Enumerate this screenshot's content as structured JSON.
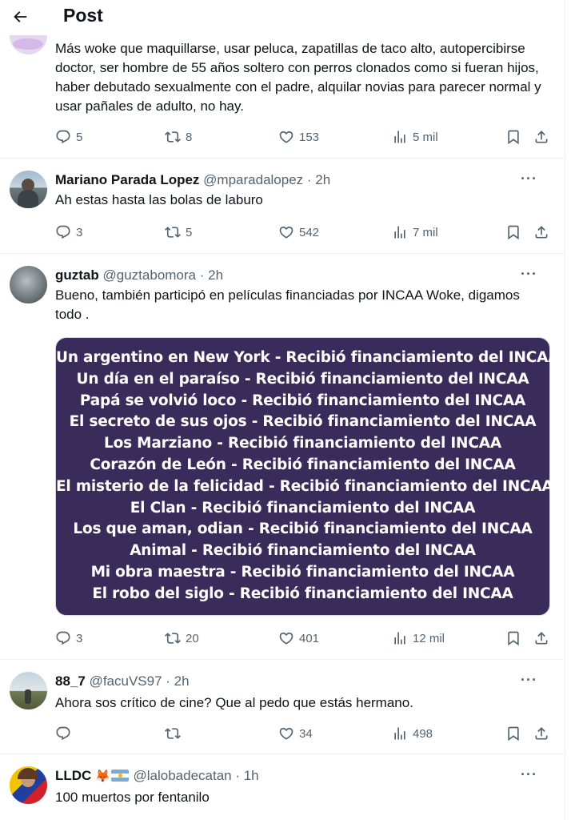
{
  "header": {
    "title": "Post"
  },
  "colors": {
    "media_bg": "#3a2c5a",
    "muted": "#536471",
    "text": "#0f1419"
  },
  "tweets": [
    {
      "text": "Más woke que maquillarse, usar peluca, zapatillas de taco alto, autopercibirse doctor, ser hombre de 55 años soltero con perros clonados como si fueran hijos, haber debutado sexualmente con el padre, alquilar novias para parecer normal y usar pañales de adulto, no hay.",
      "replies": "5",
      "retweets": "8",
      "likes": "153",
      "views": "5 mil"
    },
    {
      "name": "Mariano Parada Lopez",
      "handle": "@mparadalopez · 2h",
      "text": "Ah estas hasta las bolas de laburo",
      "replies": "3",
      "retweets": "5",
      "likes": "542",
      "views": "7 mil"
    },
    {
      "name": "guztab",
      "handle": "@guztabomora · 2h",
      "text": "Bueno, también participó en películas financiadas por INCAA Woke, digamos todo .",
      "media_lines": [
        "Un argentino en New York - Recibió financiamiento del INCAA",
        "Un día en el paraíso - Recibió financiamiento del INCAA",
        "Papá se volvió loco - Recibió financiamiento del INCAA",
        "El secreto de sus ojos - Recibió financiamiento del INCAA",
        "Los Marziano - Recibió financiamiento del INCAA",
        "Corazón de León - Recibió financiamiento del INCAA",
        "El misterio de la felicidad - Recibió financiamiento del INCAA",
        "El Clan - Recibió financiamiento del INCAA",
        "Los que aman, odian - Recibió financiamiento del INCAA",
        "Animal - Recibió financiamiento del INCAA",
        "Mi obra maestra - Recibió financiamiento del INCAA",
        "El robo del siglo - Recibió financiamiento del INCAA"
      ],
      "replies": "3",
      "retweets": "20",
      "likes": "401",
      "views": "12 mil"
    },
    {
      "name": "88_7",
      "handle": "@facuVS97 · 2h",
      "text": "Ahora sos crítico de cine? Que al pedo que estás hermano.",
      "replies": "",
      "retweets": "",
      "likes": "34",
      "views": "498"
    },
    {
      "name": "LLDC",
      "handle": "@lalobadecatan · 1h",
      "text": "100 muertos por fentanilo"
    }
  ]
}
